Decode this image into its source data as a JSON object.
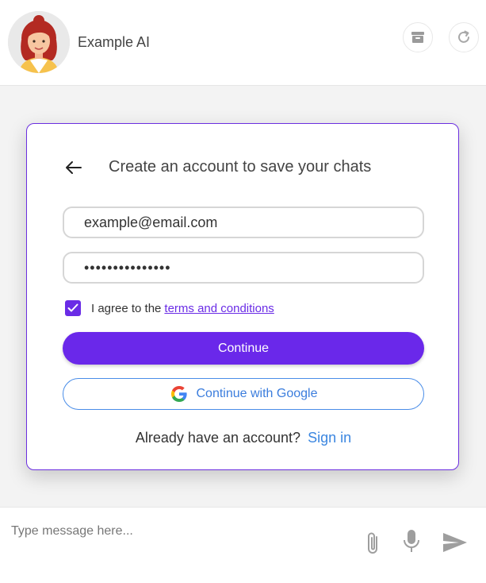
{
  "header": {
    "bot_name": "Example AI",
    "avatar_icon": "avatar-woman-red-hair",
    "archive_icon": "archive-icon",
    "refresh_icon": "refresh-icon"
  },
  "signup_card": {
    "title": "Create an account to save your chats",
    "back_icon": "arrow-left-icon",
    "email_value": "example@email.com",
    "password_value": "•••••••••••••••",
    "agree_checked": true,
    "agree_text": "I agree to the",
    "terms_link": "terms and conditions",
    "continue_label": "Continue",
    "google_label": "Continue with Google",
    "signin_prompt": "Already have an account?",
    "signin_link": "Sign in"
  },
  "input_bar": {
    "placeholder": "Type message here...",
    "attach_icon": "paperclip-icon",
    "mic_icon": "microphone-icon",
    "send_icon": "send-icon"
  },
  "colors": {
    "accent": "#6a28ea",
    "link_blue": "#3b86e0",
    "card_border": "#6b2fe0",
    "background": "#f3f3f3"
  }
}
